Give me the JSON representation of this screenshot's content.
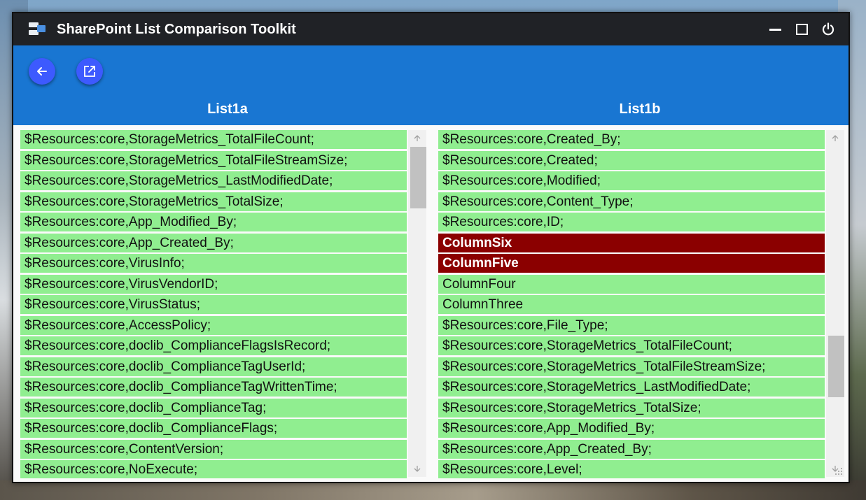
{
  "window": {
    "title": "SharePoint List Comparison Toolkit",
    "controls": [
      "minimize-icon",
      "maximize-icon",
      "power-icon"
    ]
  },
  "toolbar": {
    "buttons": [
      "back-arrow-icon",
      "open-external-icon"
    ],
    "accent": "#1976d2",
    "fab_color": "#3d5afe"
  },
  "left": {
    "header": "List1a",
    "items": [
      "$Resources:core,StorageMetrics_TotalFileCount;",
      "$Resources:core,StorageMetrics_TotalFileStreamSize;",
      "$Resources:core,StorageMetrics_LastModifiedDate;",
      "$Resources:core,StorageMetrics_TotalSize;",
      "$Resources:core,App_Modified_By;",
      "$Resources:core,App_Created_By;",
      "$Resources:core,VirusInfo;",
      "$Resources:core,VirusVendorID;",
      "$Resources:core,VirusStatus;",
      "$Resources:core,AccessPolicy;",
      "$Resources:core,doclib_ComplianceFlagsIsRecord;",
      "$Resources:core,doclib_ComplianceTagUserId;",
      "$Resources:core,doclib_ComplianceTagWrittenTime;",
      "$Resources:core,doclib_ComplianceTag;",
      "$Resources:core,doclib_ComplianceFlags;",
      "$Resources:core,ContentVersion;",
      "$Resources:core,NoExecute;"
    ],
    "scroll_position": 0.0
  },
  "right": {
    "header": "List1b",
    "items": [
      "$Resources:core,Created_By;",
      "$Resources:core,Created;",
      "$Resources:core,Modified;",
      "$Resources:core,Content_Type;",
      "$Resources:core,ID;",
      "ColumnSix",
      "ColumnFive",
      "ColumnFour",
      "ColumnThree",
      "$Resources:core,File_Type;",
      "$Resources:core,StorageMetrics_TotalFileCount;",
      "$Resources:core,StorageMetrics_TotalFileStreamSize;",
      "$Resources:core,StorageMetrics_LastModifiedDate;",
      "$Resources:core,StorageMetrics_TotalSize;",
      "$Resources:core,App_Modified_By;",
      "$Resources:core,App_Created_By;",
      "$Resources:core,Level;"
    ],
    "diff_items": [
      "ColumnSix",
      "ColumnFive"
    ],
    "scroll_position": 0.75
  },
  "colors": {
    "match": "#90ee90",
    "diff": "#8b0000"
  }
}
